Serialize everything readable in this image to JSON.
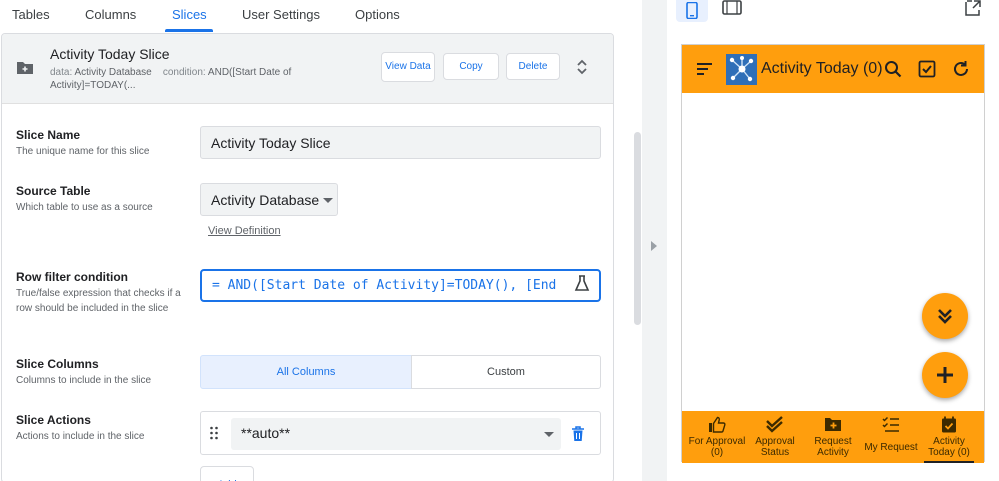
{
  "tabs": [
    {
      "label": "Tables"
    },
    {
      "label": "Columns"
    },
    {
      "label": "Slices"
    },
    {
      "label": "User Settings"
    },
    {
      "label": "Options"
    }
  ],
  "active_tab": "Slices",
  "slice_header": {
    "title": "Activity Today Slice",
    "data_label": "data:",
    "data_value": "Activity Database",
    "condition_label": "condition:",
    "condition_value": "AND([Start Date of Activity]=TODAY(...",
    "view_data_label": "View Data",
    "copy_label": "Copy",
    "delete_label": "Delete"
  },
  "fields": {
    "slice_name": {
      "label": "Slice Name",
      "description": "The unique name for this slice",
      "value": "Activity Today Slice"
    },
    "source_table": {
      "label": "Source Table",
      "description": "Which table to use as a source",
      "value": "Activity Database",
      "view_definition": "View Definition"
    },
    "row_filter": {
      "label": "Row filter condition",
      "description": "True/false expression that checks if a row should be included in the slice",
      "value": "= AND([Start Date of Activity]=TODAY(), [End"
    },
    "slice_columns": {
      "label": "Slice Columns",
      "description": "Columns to include in the slice",
      "options": [
        "All Columns",
        "Custom"
      ],
      "selected": "All Columns"
    },
    "slice_actions": {
      "label": "Slice Actions",
      "description": "Actions to include in the slice",
      "value": "**auto**",
      "add_label": "Add"
    }
  },
  "preview": {
    "app_title": "Activity Today (0)",
    "nav_items": [
      {
        "line1": "For Approval",
        "line2": "(0)"
      },
      {
        "line1": "Approval",
        "line2": "Status"
      },
      {
        "line1": "Request",
        "line2": "Activity"
      },
      {
        "line1": "My Request",
        "line2": ""
      },
      {
        "line1": "Activity",
        "line2": "Today (0)"
      }
    ],
    "active_nav": "Activity Today (0)"
  },
  "colors": {
    "accent": "#1a73e8",
    "app_orange": "#ff9e0d",
    "header_gray": "#f1f3f4"
  },
  "icons": [
    "folder-add-icon",
    "unfold-icon",
    "flask-icon",
    "drag-handle-icon",
    "trash-icon",
    "menu-icon",
    "search-icon",
    "checkbox-icon",
    "refresh-icon",
    "double-chevron-down-icon",
    "plus-icon",
    "thumbs-up-icon",
    "double-check-icon",
    "add-box-icon",
    "checklist-icon",
    "calendar-check-icon",
    "phone-icon",
    "tablet-icon",
    "fullscreen-icon"
  ]
}
